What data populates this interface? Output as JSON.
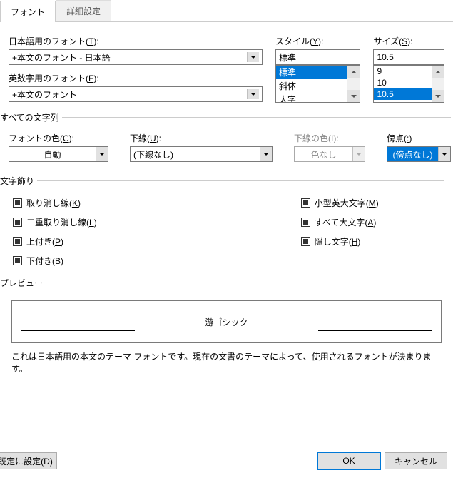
{
  "tabs": {
    "font": "フォント",
    "advanced": "詳細設定"
  },
  "labels": {
    "jp_font": "日本語用のフォント(",
    "jp_font_key": "T",
    "en_font": "英数字用のフォント(",
    "en_font_key": "F",
    "style": "スタイル(",
    "style_key": "Y",
    "size": "サイズ(",
    "size_key": "S",
    "close_paren": "):"
  },
  "values": {
    "jp_font": "+本文のフォント - 日本語",
    "en_font": "+本文のフォント",
    "style": "標準",
    "size": "10.5"
  },
  "style_list": [
    "標準",
    "斜体",
    "太字"
  ],
  "size_list": [
    "9",
    "10",
    "10.5"
  ],
  "size_selected": "10.5",
  "style_selected": "標準",
  "section_all": "すべての文字列",
  "combo": {
    "color_label": "フォントの色(",
    "color_key": "C",
    "underline_label": "下線(",
    "underline_key": "U",
    "ulcolor_label": "下線の色(",
    "ulcolor_key": "I",
    "emphasis_label": "傍点(",
    "emphasis_key": ":",
    "color_val": "自動",
    "underline_val": "(下線なし)",
    "ulcolor_val": "色なし",
    "emphasis_val": "(傍点なし)"
  },
  "section_deco": "文字飾り",
  "checks": {
    "strike": "取り消し線(",
    "strike_key": "K",
    "dstrike": "二重取り消し線(",
    "dstrike_key": "L",
    "super": "上付き(",
    "super_key": "P",
    "sub": "下付き(",
    "sub_key": "B",
    "smallcaps": "小型英大文字(",
    "smallcaps_key": "M",
    "allcaps": "すべて大文字(",
    "allcaps_key": "A",
    "hidden": "隠し文字(",
    "hidden_key": "H",
    "close": ")"
  },
  "section_preview": "プレビュー",
  "preview_text": "游ゴシック",
  "desc": "これは日本語用の本文のテーマ フォントです。現在の文書のテーマによって、使用されるフォントが決まります。",
  "buttons": {
    "setdefault": "既定に設定(D)",
    "ok": "OK",
    "cancel": "キャンセル"
  }
}
